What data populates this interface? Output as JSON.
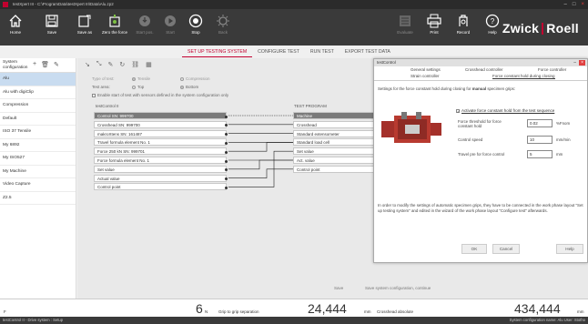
{
  "window": {
    "title": "testXpert III - C:\\ProgramData\\testXpert III\\Data\\Alu.zp2"
  },
  "ribbon": {
    "home": "Home",
    "save": "Save",
    "save_as": "Save as",
    "zero_force": "Zero the force",
    "start_pos": "Start pos.",
    "start": "Start",
    "stop": "Stop",
    "back": "Back",
    "evaluate": "Evaluate",
    "print": "Print",
    "record": "Record",
    "help": "Help"
  },
  "brand": {
    "left": "Zwick",
    "right": "Roell",
    "accent": "#c2002f"
  },
  "nav_tabs": [
    "SET UP TESTING SYSTEM",
    "CONFIGURE TEST",
    "RUN TEST",
    "EXPORT TEST DATA"
  ],
  "sidebar": {
    "header": "System configuration",
    "items": [
      "Alu",
      "Alu with digiClip",
      "Compression",
      "Default",
      "ISO 37 Tensile",
      "My 6892",
      "My ISO527",
      "My Machine",
      "Video Capture",
      "Z2.5"
    ]
  },
  "main": {
    "type_label": "Type of test:",
    "type_opt1": "Tensile",
    "type_opt2": "Compression",
    "area_label": "Test area:",
    "area_opt1": "Top",
    "area_opt2": "Bottom",
    "enable_check": "Enable start of test with sensors defined in the system configuration only",
    "left_head": "testControl II",
    "right_head": "TEST PROGRAM",
    "left_rows": [
      "Control SN: 999700",
      "Crosshead SN: 999700",
      "makroXtens SN: 161487",
      "Travel formula element No. 1",
      "Force 250 kN SN: 999701",
      "Force formula element No. 1",
      "Set value",
      "Actual value",
      "Control point"
    ],
    "right_rows": [
      "Machine",
      "Crosshead",
      "Standard extensometer",
      "Standard load cell",
      "Set value",
      "Act. value",
      "Control point"
    ],
    "save_btn": "Save",
    "save_cont_btn": "Save system configuration, continue"
  },
  "dialog": {
    "title": "testControl",
    "tabs_row1": [
      "General settings",
      "Crosshead controller",
      "Force controller"
    ],
    "tabs_row2": [
      "Strain controller",
      "Force constant hold during closing"
    ],
    "intro_a": "Settings for the force constant hold during closing for ",
    "intro_b": "manual",
    "intro_c": " specimen grips:",
    "activate": "Activate force constant hold from the test sequence",
    "threshold_label": "Force threshold for force constant hold",
    "threshold_value": "0.02",
    "threshold_unit": "%Fnom",
    "speed_label": "Control speed",
    "speed_value": "10",
    "speed_unit": "mm/min",
    "travel_label": "Travel pre for force control",
    "travel_value": "5",
    "travel_unit": "mm",
    "note": "In order to modify the settings of automatic specimen grips, they have to be connected in the work phase layout \"Set up testing system\" and edited in the wizard of the work phase layout \"Configure test\" afterwards.",
    "ok": "OK",
    "cancel": "Cancel",
    "help": "Help"
  },
  "readouts": {
    "f_label": "F",
    "force_value": "6",
    "force_unit": "N",
    "grip_label": "Grip to grip separation",
    "grip_value": "24,444",
    "grip_unit": "mm",
    "cross_label": "Crosshead absolute",
    "cross_value": "434,444",
    "cross_unit": "mm"
  },
  "statusbar": {
    "left": "testControl II - Drive system : Setup",
    "right": "System configuration name: Alu   User: Stotho"
  }
}
